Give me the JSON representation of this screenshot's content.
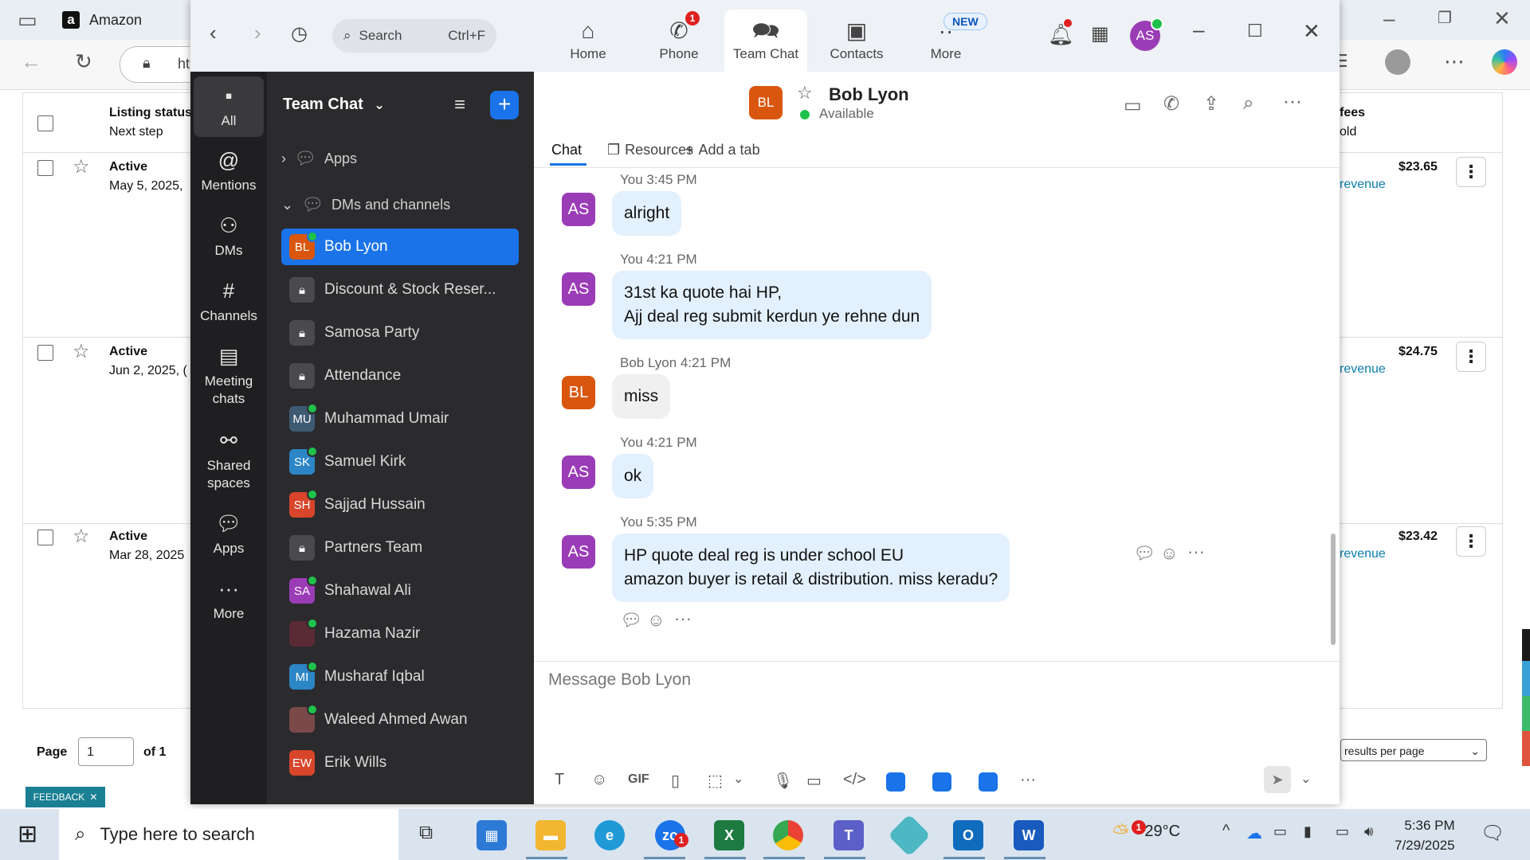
{
  "browser": {
    "tab_title": "Amazon",
    "address_text": "ht"
  },
  "bg_table": {
    "header_status": "Listing status",
    "header_next": "Next step",
    "header_fees": "fees",
    "header_fees_sub": "old",
    "rows": [
      {
        "status": "Active",
        "date": "May 5, 2025,",
        "fee": "$23.65",
        "link": "revenue"
      },
      {
        "status": "Active",
        "date": "Jun 2, 2025, (",
        "fee": "$24.75",
        "link": "revenue"
      },
      {
        "status": "Active",
        "date": "Mar 28, 2025",
        "fee": "$23.42",
        "link": "revenue"
      }
    ],
    "page_label": "Page",
    "page_value": "1",
    "page_of": "of 1",
    "per_page": "results per page",
    "feedback": "FEEDBACK"
  },
  "zoom": {
    "search_placeholder": "Search",
    "search_shortcut": "Ctrl+F",
    "nav": [
      {
        "label": "Home",
        "icon": "home-icon"
      },
      {
        "label": "Phone",
        "icon": "phone-icon",
        "badge": "1"
      },
      {
        "label": "Team Chat",
        "icon": "chat-icon"
      },
      {
        "label": "Contacts",
        "icon": "contacts-icon"
      },
      {
        "label": "More",
        "icon": "more-icon",
        "badge": "NEW"
      }
    ],
    "me_initials": "AS",
    "rail": [
      {
        "label": "All",
        "icon": "chat-bubble-icon"
      },
      {
        "label": "Mentions",
        "icon": "at-icon"
      },
      {
        "label": "DMs",
        "icon": "people-icon"
      },
      {
        "label": "Channels",
        "icon": "hash-icon"
      },
      {
        "label": "Meeting chats",
        "icon": "calendar-icon"
      },
      {
        "label": "Shared spaces",
        "icon": "share-icon"
      },
      {
        "label": "Apps",
        "icon": "apps-icon"
      },
      {
        "label": "More",
        "icon": "ellipsis-icon"
      }
    ],
    "list_title": "Team Chat",
    "section_apps": "Apps",
    "section_dms": "DMs and channels",
    "channels": [
      {
        "name": "Bob Lyon",
        "initials": "BL",
        "color": "#d9560f",
        "online": true,
        "active": true
      },
      {
        "name": "Discount & Stock Reser...",
        "initials": "",
        "color": "#4a4a4e",
        "lock": true
      },
      {
        "name": "Samosa Party",
        "initials": "",
        "color": "#4a4a4e",
        "lock": true
      },
      {
        "name": "Attendance",
        "initials": "",
        "color": "#4a4a4e",
        "lock": true
      },
      {
        "name": "Muhammad Umair",
        "initials": "MU",
        "color": "#3e5a73",
        "online": true
      },
      {
        "name": "Samuel Kirk",
        "initials": "SK",
        "color": "#2c85c5",
        "online": true
      },
      {
        "name": "Sajjad Hussain",
        "initials": "SH",
        "color": "#d8452b",
        "online": true
      },
      {
        "name": "Partners Team",
        "initials": "",
        "color": "#4a4a4e",
        "lock": true
      },
      {
        "name": "Shahawal Ali",
        "initials": "SA",
        "color": "#9b3cb7",
        "online": true
      },
      {
        "name": "Hazama Nazir",
        "initials": "",
        "color": "#5a2a35",
        "online": true
      },
      {
        "name": "Musharaf Iqbal",
        "initials": "MI",
        "color": "#2c85c5",
        "online": true
      },
      {
        "name": "Waleed Ahmed Awan",
        "initials": "",
        "color": "#7a4a4a",
        "online": true
      },
      {
        "name": "Erik Wills",
        "initials": "EW",
        "color": "#d8452b"
      }
    ],
    "chat": {
      "contact_name": "Bob Lyon",
      "contact_initials": "BL",
      "contact_status": "Available",
      "tabs": [
        "Chat",
        "Resources",
        "Add a tab"
      ],
      "messages": [
        {
          "meta": "You 3:45 PM",
          "initials": "AS",
          "text": "alright",
          "mine": true
        },
        {
          "meta": "You 4:21 PM",
          "initials": "AS",
          "text": "31st ka quote hai HP,\nAjj deal reg submit kerdun ye rehne dun",
          "mine": true
        },
        {
          "meta": "Bob Lyon 4:21 PM",
          "initials": "BL",
          "text": "miss",
          "mine": false
        },
        {
          "meta": "You 4:21 PM",
          "initials": "AS",
          "text": "ok",
          "mine": true
        },
        {
          "meta": "You 5:35 PM",
          "initials": "AS",
          "text": "HP quote deal reg is under school EU\namazon buyer is retail & distribution. miss keradu?",
          "mine": true
        }
      ],
      "composer_placeholder": "Message Bob Lyon"
    }
  },
  "taskbar": {
    "search_placeholder": "Type here to search",
    "weather_temp": "29°C",
    "weather_badge": "1",
    "zoom_badge": "1",
    "time": "5:36 PM",
    "date": "7/29/2025"
  },
  "colors": {
    "accent": "#1a73e8",
    "me_avatar": "#9b3cb7",
    "bob_avatar": "#d9560f",
    "bubble_mine": "#e3f0fd",
    "bubble_theirs": "#f0f0f0"
  }
}
